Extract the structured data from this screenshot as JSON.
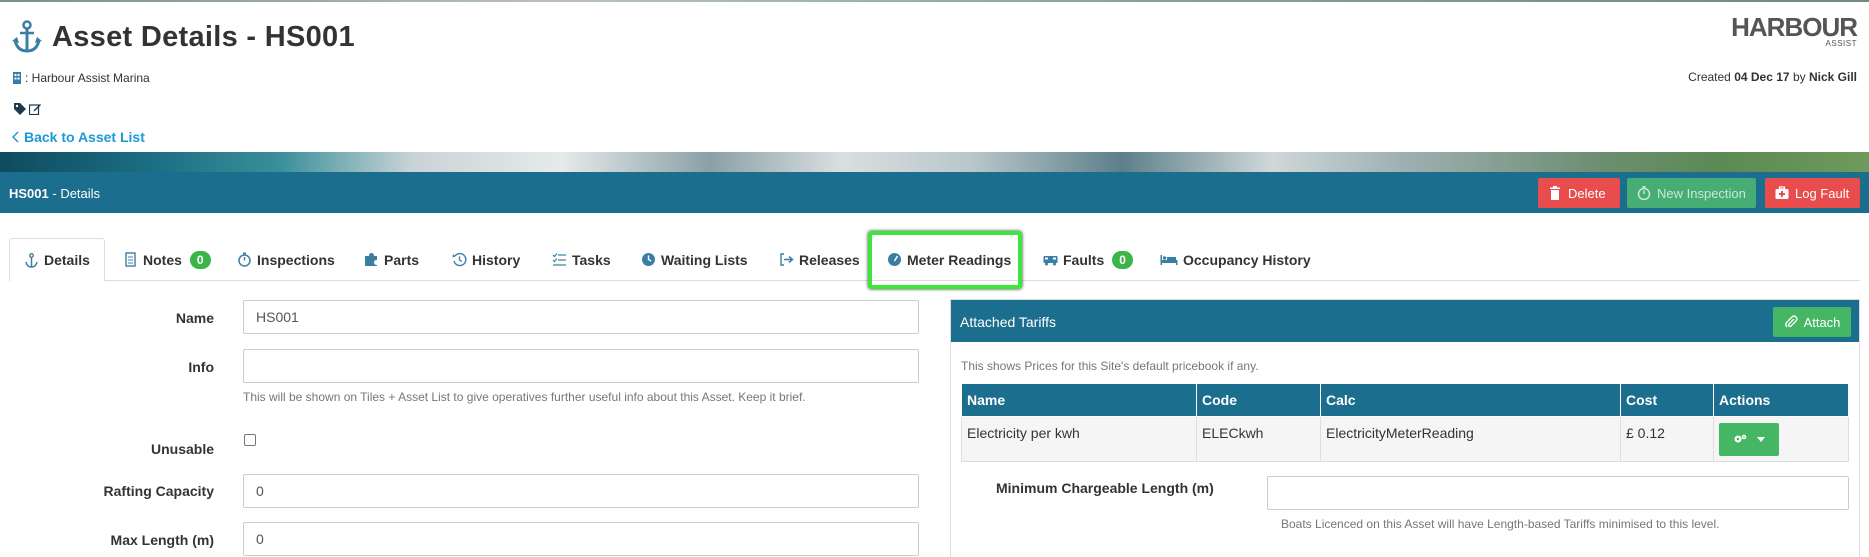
{
  "header": {
    "title": "Asset Details - HS001",
    "site": ": Harbour Assist Marina",
    "back_link": "Back to Asset List",
    "logo_main": "HARBOUR",
    "logo_sub": "ASSIST",
    "created_prefix": "Created",
    "created_date": "04 Dec 17",
    "created_by_prefix": "by",
    "created_by": "Nick Gill"
  },
  "bar": {
    "asset_code": "HS001",
    "section": "- Details",
    "delete_label": "Delete",
    "new_inspection_label": "New Inspection",
    "log_fault_label": "Log Fault"
  },
  "tabs": [
    {
      "label": "Details",
      "icon": "anchor-icon"
    },
    {
      "label": "Notes",
      "icon": "document-icon",
      "badge": "0"
    },
    {
      "label": "Inspections",
      "icon": "stopwatch-icon"
    },
    {
      "label": "Parts",
      "icon": "puzzle-icon"
    },
    {
      "label": "History",
      "icon": "history-icon"
    },
    {
      "label": "Tasks",
      "icon": "tasks-icon"
    },
    {
      "label": "Waiting Lists",
      "icon": "clock-icon"
    },
    {
      "label": "Releases",
      "icon": "release-icon"
    },
    {
      "label": "Meter Readings",
      "icon": "meter-icon"
    },
    {
      "label": "Faults",
      "icon": "ambulance-icon",
      "badge": "0"
    },
    {
      "label": "Occupancy History",
      "icon": "bed-icon"
    }
  ],
  "form": {
    "name_label": "Name",
    "name_value": "HS001",
    "info_label": "Info",
    "info_value": "",
    "info_help": "This will be shown on Tiles + Asset List to give operatives further useful info about this Asset. Keep it brief.",
    "unusable_label": "Unusable",
    "rafting_label": "Rafting Capacity",
    "rafting_value": "0",
    "maxlen_label": "Max Length (m)",
    "maxlen_value": "0"
  },
  "tariffs": {
    "title": "Attached Tariffs",
    "attach_label": "Attach",
    "note": "This shows Prices for this Site's default pricebook if any.",
    "columns": [
      "Name",
      "Code",
      "Calc",
      "Cost",
      "Actions"
    ],
    "rows": [
      [
        "Electricity per kwh",
        "ELECkwh",
        "ElectricityMeterReading",
        "£ 0.12"
      ]
    ],
    "min_length_label": "Minimum Chargeable Length (m)",
    "min_length_help": "Boats Licenced on this Asset will have Length-based Tariffs minimised to this level."
  },
  "colors": {
    "primary": "#1b6e8e",
    "danger": "#e84c4c",
    "success": "#45b764",
    "link": "#1a9ad6",
    "highlight": "#3ee53a"
  }
}
